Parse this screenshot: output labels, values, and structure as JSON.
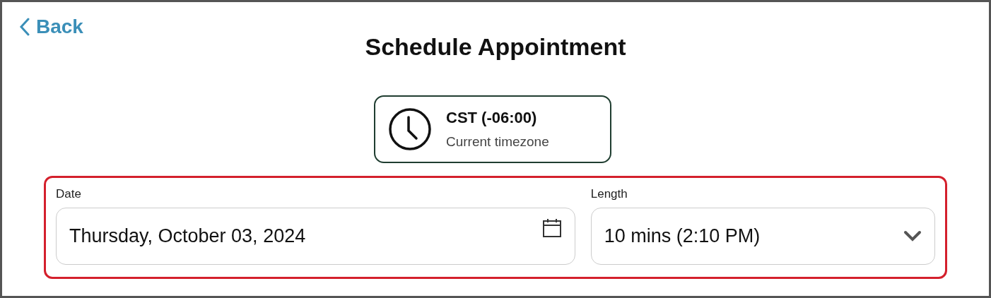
{
  "back": {
    "label": "Back"
  },
  "title": "Schedule Appointment",
  "timezone": {
    "name": "CST (-06:00)",
    "caption": "Current timezone"
  },
  "form": {
    "highlighted": true,
    "date": {
      "label": "Date",
      "value": "Thursday, October 03, 2024"
    },
    "length": {
      "label": "Length",
      "value": "10 mins (2:10 PM)"
    }
  }
}
